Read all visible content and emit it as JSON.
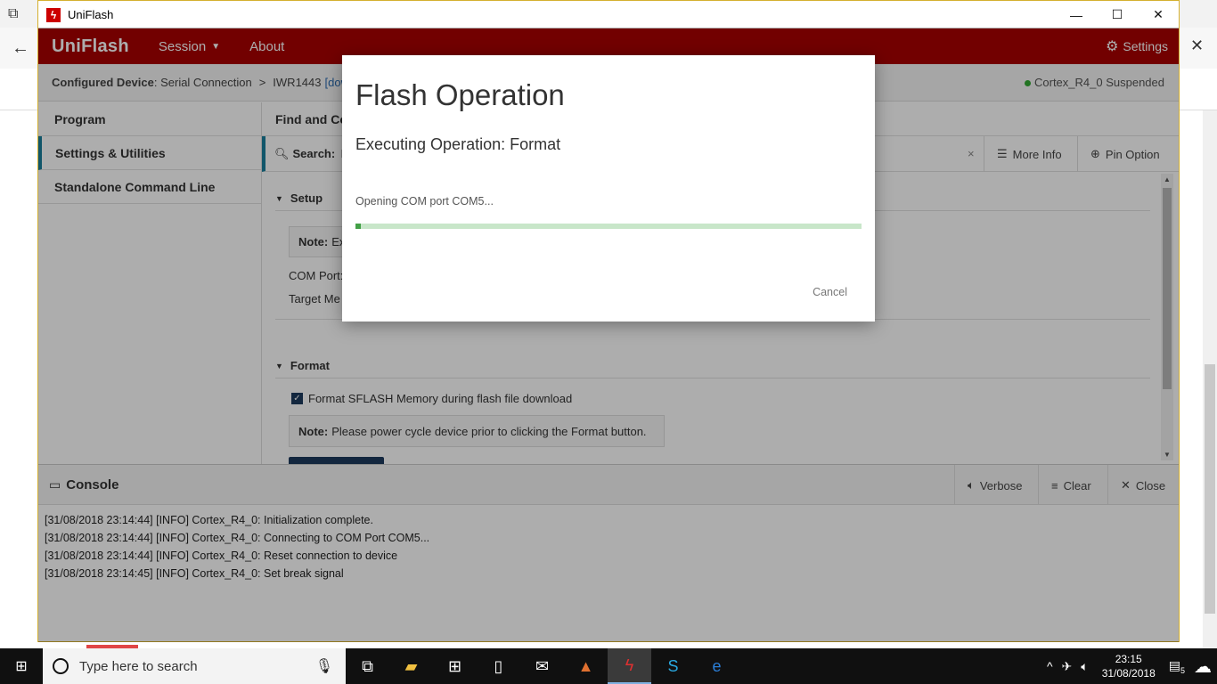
{
  "window": {
    "title": "UniFlash",
    "minimize": "—",
    "maximize": "☐",
    "close": "✕"
  },
  "appbar": {
    "brand": "UniFlash",
    "menu_session": "Session",
    "menu_about": "About",
    "settings": "Settings"
  },
  "breadcrumb": {
    "configured_device_label": "Configured Device",
    "connection": " : Serial Connection",
    "separator": ">",
    "device": "IWR1443",
    "link": "[dow",
    "status": "Cortex_R4_0 Suspended"
  },
  "sidebar": {
    "items": [
      "Program",
      "Settings & Utilities",
      "Standalone Command Line"
    ]
  },
  "content": {
    "section_title": "Find and Co",
    "search_label": "Search:",
    "search_placeholder": "E",
    "more_info": "More Info",
    "pin_option": "Pin Option",
    "setup_title": "Setup",
    "setup_note_label": "Note:",
    "setup_note_text": "Ex",
    "com_port_label": "COM Port:",
    "target_memory_label": "Target Me",
    "format_title": "Format",
    "format_checkbox_label": "Format SFLASH Memory during flash file download",
    "format_note_label": "Note:",
    "format_note_text": "Please power cycle device prior to clicking the Format button."
  },
  "console": {
    "title": "Console",
    "verbose": "Verbose",
    "clear": "Clear",
    "close": "Close",
    "lines": [
      "[31/08/2018 23:14:44] [INFO] Cortex_R4_0: Initialization complete.",
      "[31/08/2018 23:14:44] [INFO] Cortex_R4_0: Connecting to COM Port COM5...",
      "[31/08/2018 23:14:44] [INFO] Cortex_R4_0: Reset connection to device",
      "[31/08/2018 23:14:45] [INFO] Cortex_R4_0: Set break signal"
    ]
  },
  "modal": {
    "title": "Flash Operation",
    "subtitle": "Executing Operation: Format",
    "message": "Opening COM port COM5...",
    "progress_fraction": 0.01,
    "cancel": "Cancel"
  },
  "taskbar": {
    "search_placeholder": "Type here to search",
    "time": "23:15",
    "date": "31/08/2018",
    "notification_count": "5"
  },
  "colors": {
    "brand_red": "#a80000",
    "accent_teal": "#1a7f9c",
    "progress_fill": "#43a047",
    "progress_track": "#c8e6c9"
  }
}
